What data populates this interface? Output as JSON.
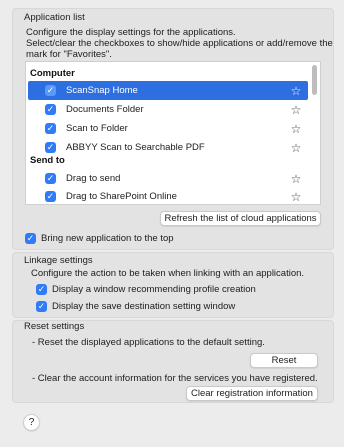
{
  "application_list": {
    "title": "Application list",
    "description_line1": "Configure the display settings for the applications.",
    "description_line2": "Select/clear the checkboxes to show/hide applications or add/remove the",
    "description_line3": "mark for \"Favorites\".",
    "groups": [
      {
        "name": "Computer",
        "items": [
          {
            "label": "ScanSnap Home",
            "checked": true,
            "selected": true
          },
          {
            "label": "Documents Folder",
            "checked": true,
            "selected": false
          },
          {
            "label": "Scan to Folder",
            "checked": true,
            "selected": false
          },
          {
            "label": "ABBYY Scan to Searchable PDF",
            "checked": true,
            "selected": false
          }
        ]
      },
      {
        "name": "Send to",
        "items": [
          {
            "label": "Drag to send",
            "checked": true,
            "selected": false
          },
          {
            "label": "Drag to SharePoint Online",
            "checked": true,
            "selected": false
          }
        ]
      }
    ],
    "refresh_label": "Refresh the list of cloud applications",
    "bring_to_top_label": "Bring new application to the top",
    "bring_to_top_checked": true
  },
  "linkage": {
    "title": "Linkage settings",
    "description": "Configure the action to be taken when linking with an application.",
    "option1": "Display a window recommending profile creation",
    "option2": "Display the save destination setting window"
  },
  "reset": {
    "title": "Reset settings",
    "line1": "- Reset the displayed applications to the default setting.",
    "reset_label": "Reset",
    "line2": "- Clear the account information for the services you have registered.",
    "clear_label": "Clear registration information"
  },
  "help_label": "?",
  "icons": {
    "checkbox": "checkmark-icon",
    "favorite": "star-outline-icon",
    "help": "question-mark-icon"
  },
  "colors": {
    "accent": "#2f7cf6",
    "selection": "#2d6fe0"
  }
}
